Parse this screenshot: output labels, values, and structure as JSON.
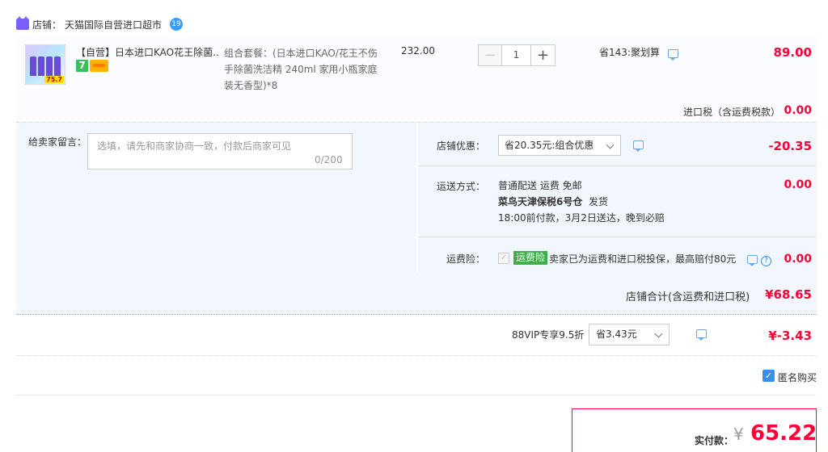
{
  "shop": {
    "label": "店铺：",
    "name": "天猫国际自营进口超市",
    "ww_badge": "19"
  },
  "item": {
    "title": "【自营】日本进口KAO花王除菌...",
    "badge_seven": "7",
    "sku": "组合套餐：(日本进口KAO/花王不伤手除菌洗洁精 240ml 家用小瓶家庭装无香型)*8",
    "price": "232.00",
    "quantity": "1",
    "minus": "−",
    "plus": "+",
    "saving": "省143:聚划算",
    "amount": "89.00",
    "thumb_tag": "75.7"
  },
  "tax": {
    "label": "进口税（含运费税款）",
    "value": "0.00"
  },
  "message": {
    "label": "给卖家留言：",
    "placeholder": "选填，请先和商家协商一致，付款后商家可见",
    "count": "0/200"
  },
  "coupon": {
    "label": "店铺优惠：",
    "selected": "省20.35元:组合优惠",
    "value": "-20.35"
  },
  "shipping": {
    "label": "运送方式：",
    "line1": "普通配送 运费 免邮",
    "line2_bold": "菜鸟天津保税6号仓",
    "line2_rest": "发货",
    "line3": "18:00前付款，3月2日送达，晚到必赔",
    "value": "0.00"
  },
  "insurance": {
    "label": "运费险：",
    "tag": "运费险",
    "text": "卖家已为运费和进口税投保，最高赔付80元",
    "value": "0.00",
    "help": "?"
  },
  "shop_total": {
    "label": "店铺合计(含运费和进口税)",
    "value": "¥68.65"
  },
  "vip": {
    "label": "88VIP专享9.5折",
    "selected": "省3.43元",
    "value": "¥-3.43"
  },
  "anonymous": {
    "label": "匿名购买",
    "checked": "✓"
  },
  "payment": {
    "label": "实付款：",
    "currency": "¥",
    "value": "65.22"
  },
  "colors": {
    "accent_red": "#ff0036",
    "panel_bg": "#f2f7ff",
    "link_blue": "#3a8ee6",
    "insurance_green": "#3fae49"
  }
}
